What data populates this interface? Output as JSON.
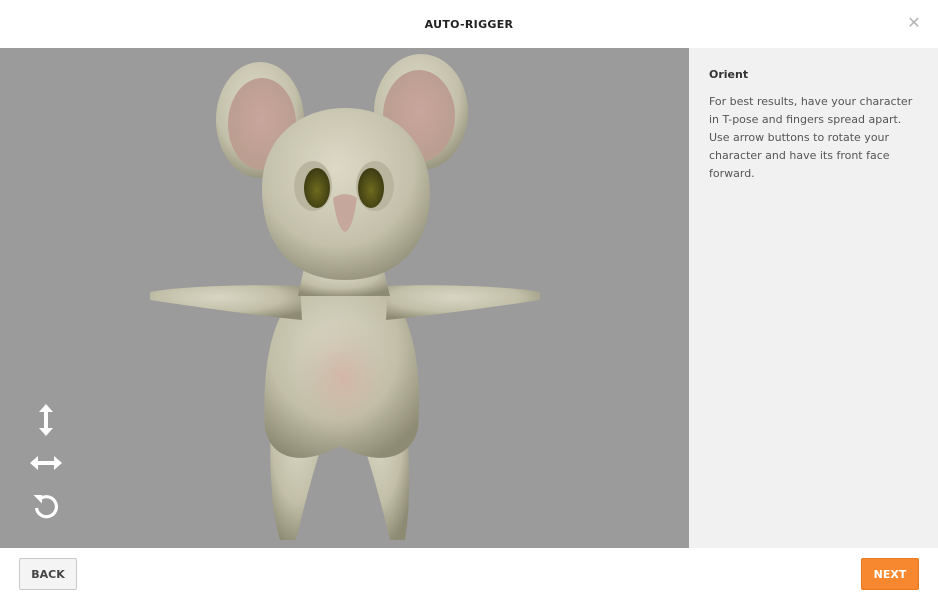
{
  "header": {
    "title": "AUTO-RIGGER",
    "close_icon": "close-icon"
  },
  "viewport": {
    "background": "#9b9b9b",
    "controls": [
      {
        "icon": "vertical-arrows-icon"
      },
      {
        "icon": "horizontal-arrows-icon"
      },
      {
        "icon": "rotate-icon"
      }
    ]
  },
  "panel": {
    "title": "Orient",
    "description": "For best results, have your character in T-pose and fingers spread apart. Use arrow buttons to rotate your character and have its front face forward."
  },
  "footer": {
    "back_label": "BACK",
    "next_label": "NEXT",
    "accent": "#f7882f"
  }
}
